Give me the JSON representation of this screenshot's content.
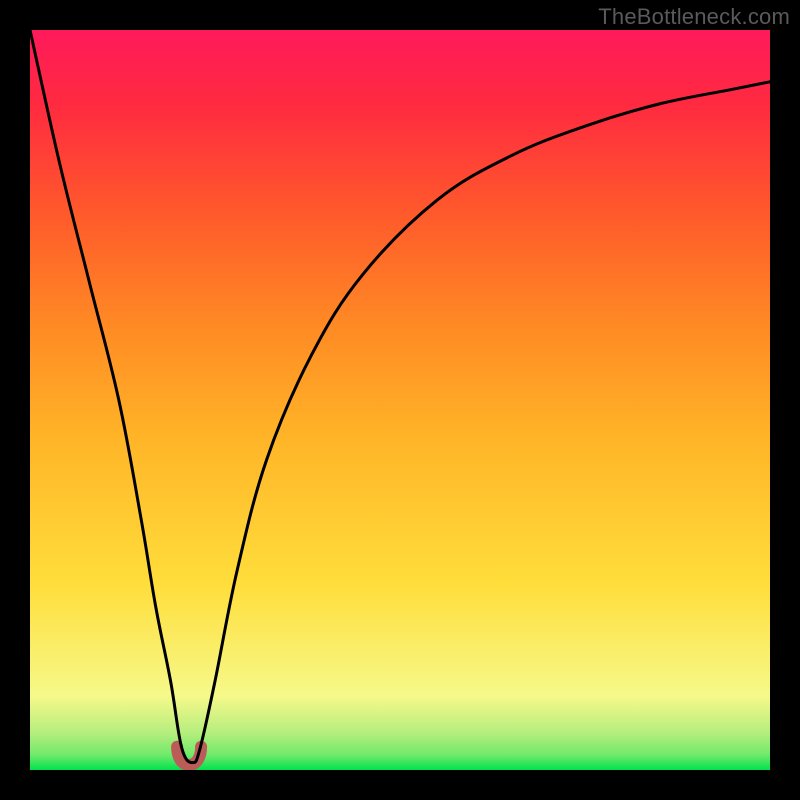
{
  "watermark": "TheBottleneck.com",
  "colors": {
    "black": "#000000",
    "curve": "#000000",
    "dip_marker": "#bb5c59",
    "green": "#00e34d",
    "pale_green": "#b5ee7e",
    "pale_yellow": "#f6f98a",
    "yellow": "#ffde3b",
    "orange": "#ff9a24",
    "red_orange": "#ff5a2b",
    "red": "#ff183a",
    "hot_pink": "#ff1a5b"
  },
  "chart_data": {
    "type": "line",
    "title": "",
    "xlabel": "",
    "ylabel": "",
    "xlim": [
      0,
      100
    ],
    "ylim": [
      0,
      100
    ],
    "series": [
      {
        "name": "bottleneck-curve",
        "x": [
          0,
          4,
          8,
          12,
          15,
          17,
          19,
          20.5,
          22,
          23,
          25,
          28,
          32,
          38,
          45,
          55,
          65,
          75,
          85,
          95,
          100
        ],
        "values": [
          100,
          82,
          66,
          50,
          34,
          22,
          12,
          3,
          1,
          3,
          12,
          27,
          42,
          56,
          67,
          77,
          83,
          87,
          90,
          92,
          93
        ]
      }
    ],
    "annotations": [
      {
        "name": "dip-marker",
        "x": 21.5,
        "y": 1.5,
        "shape": "u",
        "color": "#bb5c59"
      }
    ],
    "background_gradient_stops": [
      {
        "pos": 0.0,
        "color": "#00e34d"
      },
      {
        "pos": 0.02,
        "color": "#6fe96a"
      },
      {
        "pos": 0.05,
        "color": "#b5ee7e"
      },
      {
        "pos": 0.1,
        "color": "#f6f98a"
      },
      {
        "pos": 0.25,
        "color": "#ffde3b"
      },
      {
        "pos": 0.45,
        "color": "#ffb427"
      },
      {
        "pos": 0.6,
        "color": "#ff8a24"
      },
      {
        "pos": 0.75,
        "color": "#ff5a2b"
      },
      {
        "pos": 0.9,
        "color": "#ff2a40"
      },
      {
        "pos": 1.0,
        "color": "#ff1a5b"
      }
    ]
  }
}
